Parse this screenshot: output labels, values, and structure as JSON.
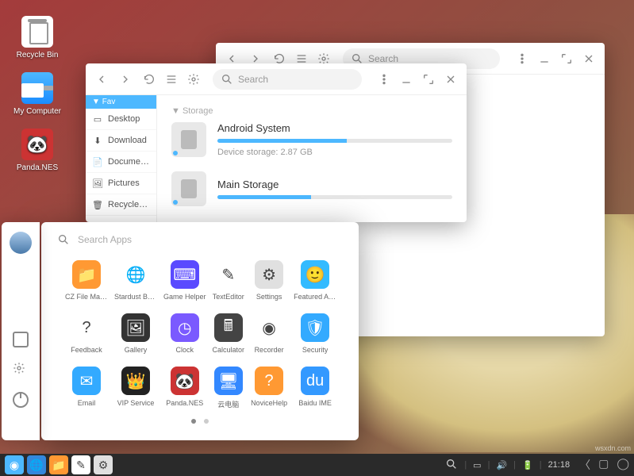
{
  "desktop": {
    "icons": [
      {
        "name": "recycle-bin",
        "label": "Recycle Bin"
      },
      {
        "name": "my-computer",
        "label": "My Computer"
      },
      {
        "name": "panda-nes",
        "label": "Panda.NES"
      }
    ]
  },
  "windows": {
    "back": {
      "search_placeholder": "Search"
    },
    "front": {
      "search_placeholder": "Search",
      "sidebar": {
        "header": "Fav",
        "items": [
          {
            "icon": "desktop-icon",
            "label": "Desktop"
          },
          {
            "icon": "download-icon",
            "label": "Download"
          },
          {
            "icon": "document-icon",
            "label": "Docume…"
          },
          {
            "icon": "pictures-icon",
            "label": "Pictures"
          },
          {
            "icon": "recycle-icon",
            "label": "Recycle…"
          }
        ]
      },
      "content": {
        "section": "Storage",
        "drives": [
          {
            "name": "Android System",
            "subtitle": "Device storage: 2.87 GB",
            "progress": 55
          },
          {
            "name": "Main Storage",
            "subtitle": "",
            "progress": 40
          }
        ]
      }
    }
  },
  "launcher": {
    "search_placeholder": "Search Apps",
    "apps": [
      {
        "label": "CZ File Man…",
        "bg": "#ff9933",
        "glyph": "📁"
      },
      {
        "label": "Stardust Br…",
        "bg": "#fff",
        "glyph": "🌐"
      },
      {
        "label": "Game Helper",
        "bg": "#5a4aff",
        "glyph": "⌨"
      },
      {
        "label": "TextEditor",
        "bg": "#fff",
        "glyph": "✎"
      },
      {
        "label": "Settings",
        "bg": "#e0e0e0",
        "glyph": "⚙"
      },
      {
        "label": "Featured App",
        "bg": "#33bbff",
        "glyph": "🙂"
      },
      {
        "label": "Feedback",
        "bg": "#fff",
        "glyph": "?"
      },
      {
        "label": "Gallery",
        "bg": "#333",
        "glyph": "🖼"
      },
      {
        "label": "Clock",
        "bg": "#7a5aff",
        "glyph": "◷"
      },
      {
        "label": "Calculator",
        "bg": "#444",
        "glyph": "🖩"
      },
      {
        "label": "Recorder",
        "bg": "#fff",
        "glyph": "◉"
      },
      {
        "label": "Security",
        "bg": "#33aaff",
        "glyph": "🛡"
      },
      {
        "label": "Email",
        "bg": "#33aaff",
        "glyph": "✉"
      },
      {
        "label": "VIP Service",
        "bg": "#222",
        "glyph": "👑"
      },
      {
        "label": "Panda.NES",
        "bg": "#cc3333",
        "glyph": "🐼"
      },
      {
        "label": "云电脑",
        "bg": "#3388ff",
        "glyph": "🖥"
      },
      {
        "label": "NoviceHelp",
        "bg": "#ff9933",
        "glyph": "?"
      },
      {
        "label": "Baidu IME",
        "bg": "#3399ff",
        "glyph": "du"
      }
    ]
  },
  "taskbar": {
    "time": "21:18",
    "running": [
      {
        "name": "browser",
        "bg": "#3388dd",
        "glyph": "🌐"
      },
      {
        "name": "file-manager",
        "bg": "#ff9933",
        "glyph": "📁"
      },
      {
        "name": "text-editor",
        "bg": "#fff",
        "glyph": "✎"
      },
      {
        "name": "settings",
        "bg": "#e0e0e0",
        "glyph": "⚙"
      }
    ]
  },
  "watermark": "wsxdn.com"
}
